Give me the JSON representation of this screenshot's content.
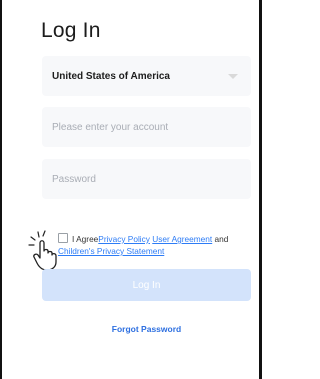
{
  "header": {
    "title": "Log In"
  },
  "form": {
    "country": "United States of America",
    "account_placeholder": "Please enter your account",
    "password_placeholder": "Password"
  },
  "agreement": {
    "prefix": "I Agree",
    "privacy_policy": "Privacy Policy",
    "user_agreement": "User Agreement",
    "and": "and",
    "childrens_privacy": "Children's Privacy Statement"
  },
  "actions": {
    "login_label": "Log In",
    "forgot_password": "Forgot Password"
  },
  "colors": {
    "link": "#2d7cf6",
    "button_disabled": "#d3e3fb",
    "field_bg": "#f7f8fa"
  },
  "icons": [
    "chevron-down-icon",
    "tap-hand-icon",
    "checkbox"
  ]
}
